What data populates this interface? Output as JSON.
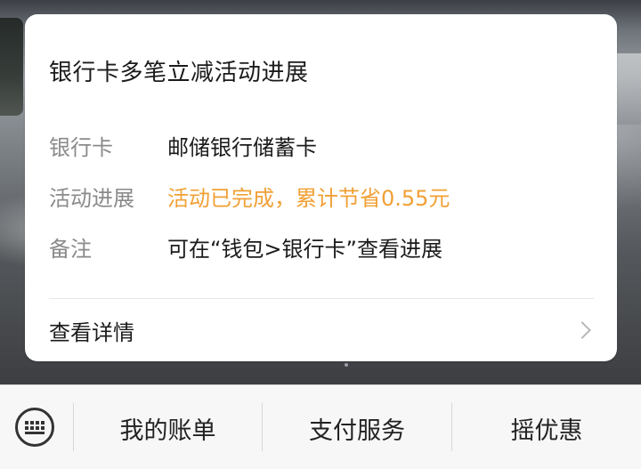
{
  "card": {
    "title": "银行卡多笔立减活动进展",
    "rows": [
      {
        "label": "银行卡",
        "value": "邮储银行储蓄卡"
      },
      {
        "label": "活动进展",
        "value": "活动已完成，累计节省0.55元"
      },
      {
        "label": "备注",
        "value": "可在“钱包>银行卡”查看进展"
      }
    ],
    "details_label": "查看详情"
  },
  "bottom_menu": {
    "keyboard_icon": "keyboard-icon",
    "items": [
      {
        "label": "我的账单"
      },
      {
        "label": "支付服务"
      },
      {
        "label": "摇优惠"
      }
    ]
  },
  "colors": {
    "accent": "#f0a035",
    "label": "#8a8a8a",
    "text": "#1b1b1b"
  }
}
